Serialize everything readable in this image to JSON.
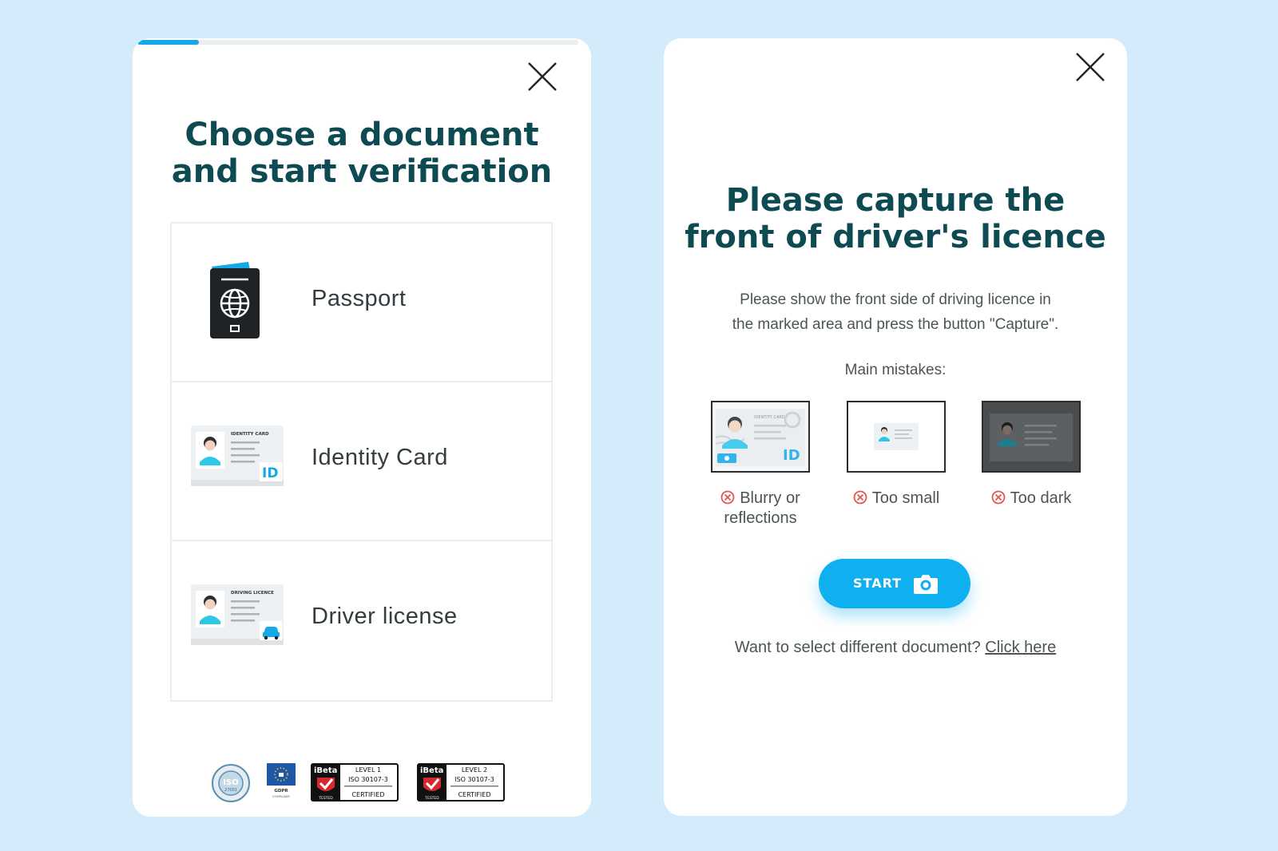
{
  "left": {
    "progress": 0.14,
    "title_line1": "Choose a document",
    "title_line2": "and start verification",
    "documents": [
      {
        "label": "Passport",
        "icon": "passport-icon"
      },
      {
        "label": "Identity Card",
        "icon": "identity-card-icon",
        "card_caption": "IDENTITY CARD",
        "card_mark": "ID"
      },
      {
        "label": "Driver license",
        "icon": "driving-licence-icon",
        "card_caption": "DRIVING LICENCE"
      }
    ],
    "badges": [
      {
        "name": "iso-27001-badge",
        "text": "ISO",
        "sub": "27001"
      },
      {
        "name": "gdpr-badge",
        "text": "GDPR",
        "sub": "COMPLIANT"
      },
      {
        "name": "ibeta-level1-badge",
        "brand": "iBeta",
        "level": "LEVEL 1",
        "std": "ISO 30107-3",
        "tested": "TESTED",
        "cert": "CERTIFIED"
      },
      {
        "name": "ibeta-level2-badge",
        "brand": "iBeta",
        "level": "LEVEL 2",
        "std": "ISO 30107-3",
        "tested": "TESTED",
        "cert": "CERTIFIED"
      }
    ]
  },
  "right": {
    "title_line1": "Please capture the",
    "title_line2": "front of driver's licence",
    "subtitle_line1": "Please show the front side of driving licence in",
    "subtitle_line2": "the marked area and press the button \"Capture\".",
    "mistakes_label": "Main mistakes:",
    "mistakes": [
      {
        "line1": "Blurry or",
        "line2": "reflections",
        "thumb_caption": "IDENTITY CARD",
        "thumb_mark": "ID"
      },
      {
        "line1": "Too small",
        "line2": ""
      },
      {
        "line1": "Too dark",
        "line2": ""
      }
    ],
    "start_label": "START",
    "footer_text": "Want to select different document?",
    "footer_link": "Click here"
  },
  "colors": {
    "background": "#d4ebfb",
    "title": "#0d4a52",
    "accent": "#0fb0f0",
    "error": "#e0574f"
  }
}
